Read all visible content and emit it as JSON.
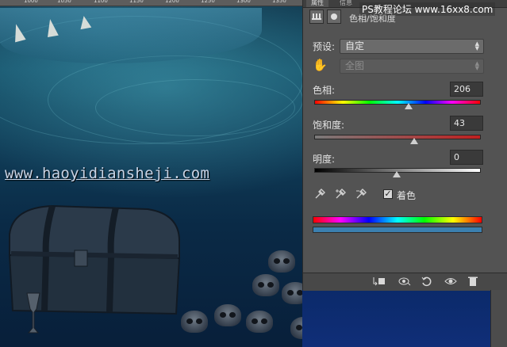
{
  "ruler": {
    "marks": [
      "1000",
      "1050",
      "1100",
      "1150",
      "1200",
      "1250",
      "1300",
      "1350"
    ]
  },
  "site_watermark": "PS教程论坛 www.16xx8.com",
  "canvas_watermark": "www.haoyidiansheji.com",
  "panel": {
    "tabs": [
      "属性",
      "信息"
    ],
    "title": "色相/饱和度",
    "preset_label": "预设:",
    "preset_value": "自定",
    "range_value": "全图",
    "hue": {
      "label": "色相:",
      "value": "206",
      "fraction": 0.572
    },
    "saturation": {
      "label": "饱和度:",
      "value": "43",
      "fraction": 0.608
    },
    "lightness": {
      "label": "明度:",
      "value": "0",
      "fraction": 0.5
    },
    "colorize_label": "着色",
    "colorize_checked": "✓",
    "icons": [
      "clip-to-layer-icon",
      "visibility-previous-icon",
      "reset-icon",
      "eye-icon",
      "trash-icon"
    ]
  },
  "colors": {
    "panel_bg": "#535353",
    "colorize_bar": "#3b80b0",
    "canvas_blue": "#0f3a55"
  }
}
